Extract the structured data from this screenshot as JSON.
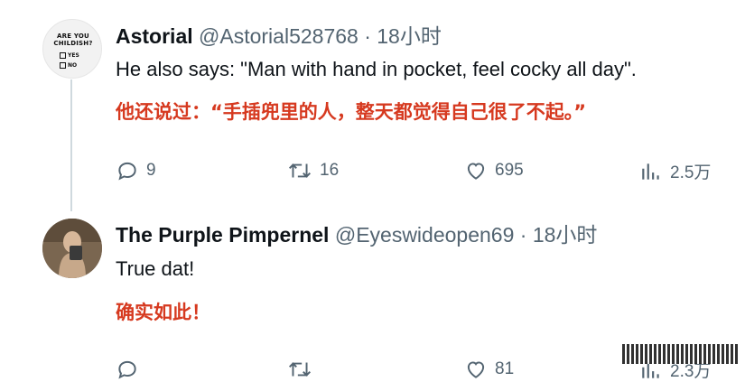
{
  "tweet1": {
    "avatar_text": "ARE YOU CHILDISH?",
    "avatar_options": [
      "YES",
      "NO"
    ],
    "name": "Astorial",
    "handle": "@Astorial528768",
    "time": "· 18小时",
    "text_en": "He also says: \"Man with hand in pocket, feel cocky all day\".",
    "text_cn": "他还说过：“手插兜里的人，整天都觉得自己很了不起。”",
    "actions": {
      "reply_count": "9",
      "retweet_count": "16",
      "like_count": "695",
      "view_count": "2.5万"
    }
  },
  "tweet2": {
    "name": "The Purple Pimpernel",
    "handle": "@Eyeswideopen69",
    "time": "· 18小时",
    "text_en": "True dat!",
    "text_cn": "确实如此！",
    "actions": {
      "like_count": "81",
      "view_count": "2.3万"
    }
  },
  "colors": {
    "text_primary": "#0f1419",
    "text_secondary": "#536471",
    "translation_red": "#d6391f",
    "thread_line": "#cfd9de"
  },
  "icons": [
    "reply-icon",
    "retweet-icon",
    "like-icon",
    "views-icon"
  ]
}
